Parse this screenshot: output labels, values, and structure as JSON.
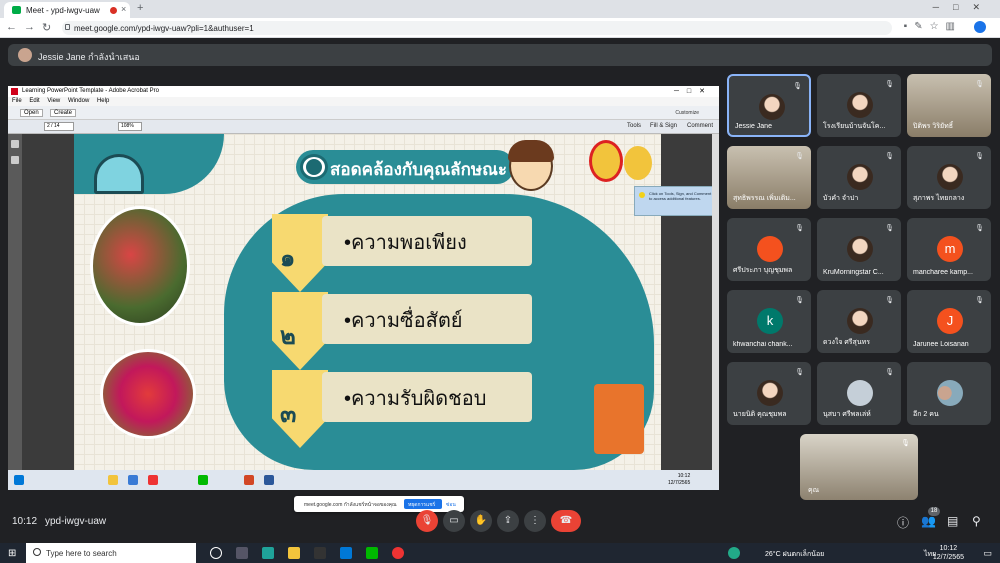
{
  "browser": {
    "tab_title": "Meet - ypd-iwgv-uaw",
    "url": "meet.google.com/ypd-iwgv-uaw?pli=1&authuser=1"
  },
  "meet": {
    "presenting_text": "Jessie Jane กำลังนำเสนอ",
    "time": "10:12",
    "meeting_code": "ypd-iwgv-uaw",
    "participant_count": "18",
    "self_name": "คุณ"
  },
  "acrobat": {
    "title": "Learning PowerPoint Template - Adobe Acrobat Pro",
    "menu": [
      "File",
      "Edit",
      "View",
      "Window",
      "Help"
    ],
    "open_label": "Open",
    "create_label": "Create",
    "customize_label": "Customize",
    "page_num": "2",
    "page_total": "/ 14",
    "zoom": "108%",
    "tools_label": "Tools",
    "fillsign_label": "Fill & Sign",
    "comment_label": "Comment",
    "tip_text": "Click on Tools, Sign, and Comment to access additional features."
  },
  "slide": {
    "title": "สอดคล้องกับคุณลักษณะ",
    "items": [
      {
        "num": "๑",
        "text": "•ความพอเพียง"
      },
      {
        "num": "๒",
        "text": "•ความซื่อสัตย์"
      },
      {
        "num": "๓",
        "text": "•ความรับผิดชอบ"
      }
    ]
  },
  "share_bar": {
    "text": "meet.google.com กำลังแชร์หน้าจอของคุณ",
    "stop_label": "หยุดการแชร์",
    "hide_label": "ซ่อน"
  },
  "inner_taskbar": {
    "time": "10:12",
    "date": "12/7/2565"
  },
  "participants": [
    {
      "name": "Jessie Jane",
      "type": "photo"
    },
    {
      "name": "โรงเรียนบ้านจันโค...",
      "type": "photo"
    },
    {
      "name": "ปิติพร วิริยัทธิ์",
      "type": "room"
    },
    {
      "name": "สุทธิพรรณ เพิ่มเติม...",
      "type": "room"
    },
    {
      "name": "บัวคำ จำปา",
      "type": "photo"
    },
    {
      "name": "สุภาพร ไทยกลาง",
      "type": "photo"
    },
    {
      "name": "ศรีประภา บุญชุมพล",
      "initial": "",
      "color": "#f4511e"
    },
    {
      "name": "KruMorningstar C...",
      "type": "photo"
    },
    {
      "name": "manchareе kamp...",
      "initial": "m",
      "color": "#f4511e"
    },
    {
      "name": "khwanchai chank...",
      "initial": "k",
      "color": "#00796b"
    },
    {
      "name": "ดวงใจ ศรีสุนทร",
      "type": "photo"
    },
    {
      "name": "Jarunee Loisanan",
      "initial": "J",
      "color": "#f4511e"
    },
    {
      "name": "นายนิติ คุณชุมพล",
      "type": "photo"
    },
    {
      "name": "นุสบา ศรีพลเล่ห์",
      "initial": "",
      "color": "#c5cfd8"
    },
    {
      "name": "อีก 2 คน",
      "type": "more"
    }
  ],
  "windows": {
    "search_placeholder": "Type here to search",
    "weather": "26°C ฝนตกเล็กน้อย",
    "lang": "ไทย",
    "time": "10:12",
    "date": "12/7/2565"
  }
}
